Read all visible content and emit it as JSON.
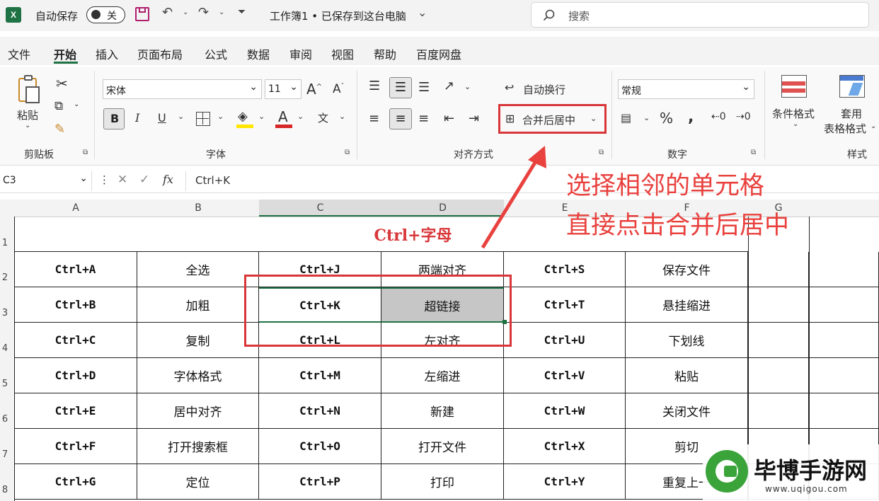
{
  "titlebar": {
    "app_icon": "X",
    "autosave_label": "自动保存",
    "autosave_state": "关",
    "doc_title": "工作簿1 • 已保存到这台电脑",
    "search_placeholder": "搜索"
  },
  "menu": {
    "tabs": [
      "文件",
      "开始",
      "插入",
      "页面布局",
      "公式",
      "数据",
      "审阅",
      "视图",
      "帮助",
      "百度网盘"
    ],
    "active": "开始"
  },
  "ribbon": {
    "clipboard": {
      "paste_label": "粘贴",
      "group_label": "剪贴板"
    },
    "font": {
      "font_name": "宋体",
      "font_size": "11",
      "group_label": "字体",
      "bold": "B",
      "italic": "I",
      "underline": "U"
    },
    "alignment": {
      "wrap_text": "自动换行",
      "merge_center": "合并后居中",
      "group_label": "对齐方式"
    },
    "number": {
      "format": "常规",
      "group_label": "数字"
    },
    "styles": {
      "conditional": "条件格式",
      "table_format_1": "套用",
      "table_format_2": "表格格式",
      "group_label": "样式"
    }
  },
  "formula_bar": {
    "name_box": "C3",
    "formula": "Ctrl+K",
    "fx": "fx"
  },
  "columns": [
    "A",
    "B",
    "C",
    "D",
    "E",
    "F",
    "G"
  ],
  "rows": [
    "1",
    "2",
    "3",
    "4",
    "5",
    "6",
    "7",
    "8"
  ],
  "sheet": {
    "title": "Ctrl+字母",
    "data": [
      [
        "Ctrl+A",
        "全选",
        "Ctrl+J",
        "两端对齐",
        "Ctrl+S",
        "保存文件"
      ],
      [
        "Ctrl+B",
        "加粗",
        "Ctrl+K",
        "超链接",
        "Ctrl+T",
        "悬挂缩进"
      ],
      [
        "Ctrl+C",
        "复制",
        "Ctrl+L",
        "左对齐",
        "Ctrl+U",
        "下划线"
      ],
      [
        "Ctrl+D",
        "字体格式",
        "Ctrl+M",
        "左缩进",
        "Ctrl+V",
        "粘贴"
      ],
      [
        "Ctrl+E",
        "居中对齐",
        "Ctrl+N",
        "新建",
        "Ctrl+W",
        "关闭文件"
      ],
      [
        "Ctrl+F",
        "打开搜索框",
        "Ctrl+O",
        "打开文件",
        "Ctrl+X",
        "剪切"
      ],
      [
        "Ctrl+G",
        "定位",
        "Ctrl+P",
        "打印",
        "Ctrl+Y",
        "重复上一"
      ]
    ]
  },
  "annotation": {
    "line1": "选择相邻的单元格",
    "line2": "直接点击合并后居中"
  },
  "watermark": {
    "name": "毕博手游网",
    "url": "www.uqigou.com"
  },
  "colors": {
    "excel_green": "#1f7244",
    "annotation_red": "#e8413e"
  }
}
